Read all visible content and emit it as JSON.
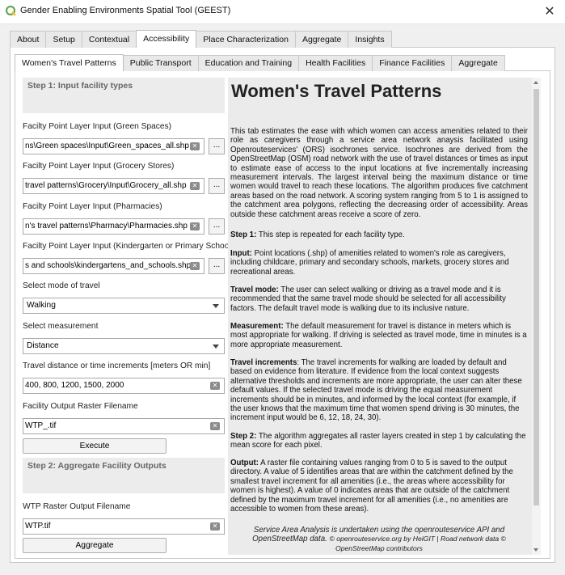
{
  "window": {
    "title": "Gender Enabling Environments Spatial Tool (GEEST)"
  },
  "tabs": [
    "About",
    "Setup",
    "Contextual",
    "Accessibility",
    "Place Characterization",
    "Aggregate",
    "Insights"
  ],
  "subtabs": [
    "Women's Travel Patterns",
    "Public Transport",
    "Education and Training",
    "Health Facilities",
    "Finance Facilities",
    "Aggregate"
  ],
  "left": {
    "step1_header": "Step 1: Input facility types",
    "green_label": "Facilty Point Layer Input (Green Spaces)",
    "green_value": "ns\\Green spaces\\Input\\Green_spaces_all.shp",
    "grocery_label": "Facilty Point Layer Input (Grocery Stores)",
    "grocery_value": "travel patterns\\Grocery\\Input\\Grocery_all.shp",
    "pharmacy_label": "Facilty Point Layer Input (Pharmacies)",
    "pharmacy_value": "n's travel patterns\\Pharmacy\\Pharmacies.shp",
    "kinder_label": "Facilty Point Layer Input (Kindergarten or Primary Schools)",
    "kinder_value": "s and schools\\kindergartens_and_schools.shp",
    "browse_label": "...",
    "mode_label": "Select mode of travel",
    "mode_value": "Walking",
    "measure_label": "Select measurement",
    "measure_value": "Distance",
    "increments_label": "Travel distance or time increments [meters OR min]",
    "increments_value": "400, 800, 1200, 1500, 2000",
    "output_label": "Facility Output Raster Filename",
    "output_value": "WTP_.tif",
    "execute": "Execute",
    "step2_header": "Step 2: Aggregate Facility Outputs",
    "wtp_label": "WTP Raster Output Filename",
    "wtp_value": "WTP.tif",
    "aggregate": "Aggregate"
  },
  "doc": {
    "title": "Women's Travel Patterns",
    "intro": "This tab estimates the ease with which women can access amenities related to their role as caregivers through a service area network anaysis facilitated using Openrouteservices' (ORS) isochrones service. Isochrones are derived from the OpenStreetMap (OSM) road network with the use of travel distances or times as input to estimate ease of access to the input locations at five incrementally increasing measurement intervals. The largest interval being the maximum distance or time women would travel to reach these locations. The algorithm produces five catchment areas based on the road network. A scoring system ranging from 5 to 1 is assigned to the catchment area polygons, reflecting the decreasing order of accessibility. Areas outside these catchment areas receive a score of zero.",
    "step1_b": "Step 1:",
    "step1_t": " This step is repeated for each facility type.",
    "input_b": "Input:",
    "input_t": " Point locations (.shp) of amenities related to women's role as caregivers, including childcare, primary and secondary schools, markets, grocery stores and recreational areas.",
    "mode_b": "Travel mode:",
    "mode_t": " The user can select walking or driving as a travel mode and it is recommended that the same travel mode should be selected for all accessibility factors. The default travel mode is walking due to its inclusive nature.",
    "meas_b": "Measurement:",
    "meas_t": " The default measurement for travel is distance in meters which is most appropriate for walking. If driving is selected as travel mode, time in minutes is a more appropriate measurement.",
    "inc_b": "Travel increments",
    "inc_t": ": The travel increments for walking are loaded by default and based on evidence from literature. If evidence from the local context suggests alternative thresholds and increments are more appropriate, the user can alter these default values. If the selected travel mode is driving the equal measurement increments should be in minutes, and informed by the local context  (for example, if the user knows that the maximum time that women spend driving is 30 minutes, the increment input would be 6, 12, 18, 24, 30).",
    "step2_b": "Step 2:",
    "step2_t": " The algorithm aggregates all raster layers created in step 1 by calculating the mean score for each pixel.",
    "out_b": "Output:",
    "out_t": " A raster file containing values ranging from 0 to 5 is saved to the output directory. A value of 5 identifies areas that are within the catchment defined by the smallest travel increment for all amenities (i.e., the areas where accessibility for women is highest). A value of 0 indicates areas that are outside of the catchment defined by the maximum travel increment for all amenities (i.e., no amenities are accessible to women from these areas).",
    "footer1": "Service Area Analysis is undertaken using the openrouteservice API and OpenStreetMap data. ",
    "footer2": "© openrouteservice.org by HeiGIT | Road network data © OpenStreetMap contributors"
  },
  "colors": {
    "icon_green": "#6aa84f",
    "icon_yellow": "#f1c232"
  },
  "icons": [
    "qgis-icon",
    "close-icon",
    "clear-icon",
    "dropdown-arrow-icon",
    "scroll-up-icon",
    "scroll-down-icon"
  ]
}
